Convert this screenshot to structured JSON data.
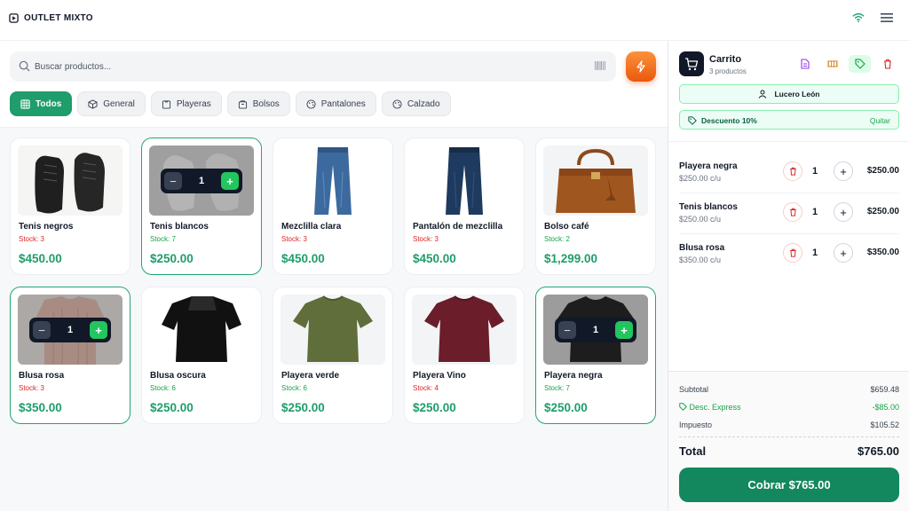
{
  "app": {
    "brand": "OUTLET MIXTO"
  },
  "search": {
    "placeholder": "Buscar productos..."
  },
  "categories": [
    {
      "label": "Todos",
      "icon": "grid-icon",
      "active": true
    },
    {
      "label": "General",
      "icon": "box-icon"
    },
    {
      "label": "Playeras",
      "icon": "shirt-icon"
    },
    {
      "label": "Bolsos",
      "icon": "bag-icon"
    },
    {
      "label": "Pantalones",
      "icon": "palette-icon"
    },
    {
      "label": "Calzado",
      "icon": "palette-icon"
    }
  ],
  "products": [
    {
      "name": "Tenis negros",
      "stock": "Stock: 3",
      "price": "$450.00"
    },
    {
      "name": "Tenis blancos",
      "stock": "Stock: 7",
      "price": "$250.00",
      "qty": "1"
    },
    {
      "name": "Mezclilla clara",
      "stock": "Stock: 3",
      "price": "$450.00"
    },
    {
      "name": "Pantalón de mezclilla",
      "stock": "Stock: 3",
      "price": "$450.00"
    },
    {
      "name": "Bolso café",
      "stock": "Stock: 2",
      "price": "$1,299.00"
    },
    {
      "name": "Blusa rosa",
      "stock": "Stock: 3",
      "price": "$350.00",
      "qty": "1"
    },
    {
      "name": "Blusa oscura",
      "stock": "Stock: 6",
      "price": "$250.00"
    },
    {
      "name": "Playera verde",
      "stock": "Stock: 6",
      "price": "$250.00"
    },
    {
      "name": "Playera Vino",
      "stock": "Stock: 4",
      "price": "$250.00"
    },
    {
      "name": "Playera negra",
      "stock": "Stock: 7",
      "price": "$250.00",
      "qty": "1"
    }
  ],
  "cart": {
    "title": "Carrito",
    "count": "3 productos",
    "customer": "Lucero León",
    "discount": "Descuento 10%",
    "discount_action": "Quitar",
    "items": [
      {
        "name": "Playera negra",
        "unit": "$250.00 c/u",
        "qty": "1",
        "total": "$250.00"
      },
      {
        "name": "Tenis blancos",
        "unit": "$250.00 c/u",
        "qty": "1",
        "total": "$250.00"
      },
      {
        "name": "Blusa rosa",
        "unit": "$350.00 c/u",
        "qty": "1",
        "total": "$350.00"
      }
    ],
    "subtotal_label": "Subtotal",
    "subtotal": "$659.48",
    "express_label": "Desc. Express",
    "express": "-$85.00",
    "tax_label": "Impuesto",
    "tax": "$105.52",
    "total_label": "Total",
    "total": "$765.00",
    "pay_label": "Cobrar $765.00"
  },
  "colors": {
    "accent": "#1f9d6b",
    "orange": "#f97316",
    "danger": "#dc2626"
  }
}
